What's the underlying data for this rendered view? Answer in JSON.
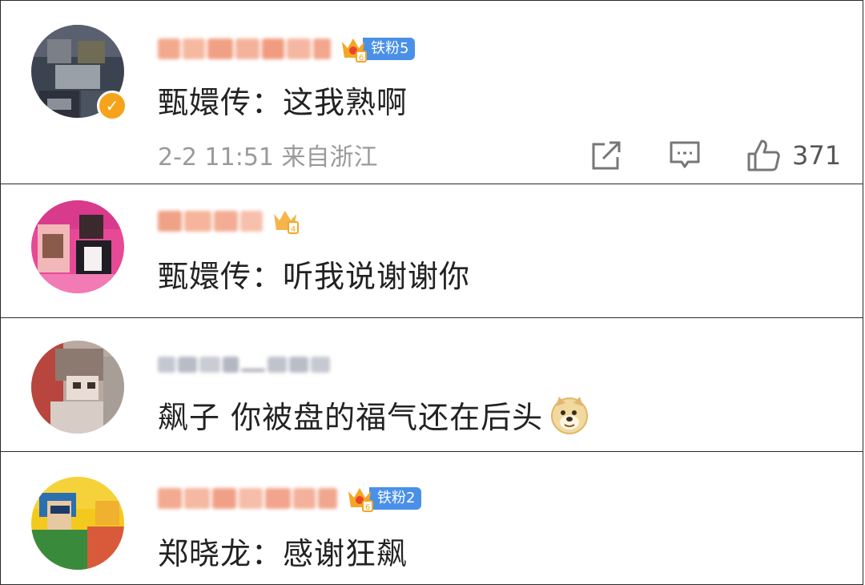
{
  "comments": [
    {
      "fan_level": "铁粉5",
      "text": "甄嬛传：这我熟啊",
      "time": "2-2 11:51",
      "location": "来自浙江",
      "likes": "371",
      "verified": true
    },
    {
      "text": "甄嬛传：听我说谢谢你"
    },
    {
      "text": "飙子 你被盘的福气还在后头",
      "emoji": "doge-emoji"
    },
    {
      "fan_level": "铁粉2",
      "text": "郑晓龙：感谢狂飙"
    }
  ],
  "colors": {
    "fan_tag": "#4a90e8",
    "crown": "#f5a623",
    "blurred_name": "#f3a98e",
    "blurred_name_gray": "#bfc3cf",
    "meta_text": "#9a9a9a"
  }
}
